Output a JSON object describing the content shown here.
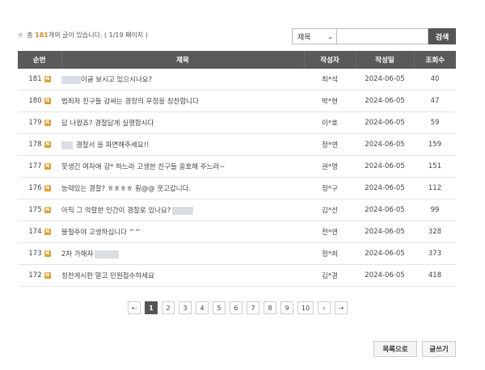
{
  "summary": {
    "star": "※",
    "pre": "총",
    "count": "181",
    "post": "개의 글이 있습니다.",
    "pages": "( 1/19 페이지 )"
  },
  "search": {
    "field": "제목",
    "button": "검색",
    "query": ""
  },
  "columns": {
    "num": "순번",
    "title": "제목",
    "writer": "작성자",
    "date": "작성일",
    "views": "조회수"
  },
  "badge": "N",
  "rows": [
    {
      "num": "181",
      "title": "이글 보시고 있으시나요?",
      "writer": "최*석",
      "date": "2024-06-05",
      "views": "40"
    },
    {
      "num": "180",
      "title": "범죄자 친구들 감싸는 경장의 우정을 칭찬합니다",
      "writer": "박*현",
      "date": "2024-06-05",
      "views": "47"
    },
    {
      "num": "179",
      "title": "답 나왔죠? 경찰답게 실행합시다",
      "writer": "이*호",
      "date": "2024-06-05",
      "views": "59"
    },
    {
      "num": "178",
      "title": "경찰서 을 파면해주세요!!",
      "writer": "정*연",
      "date": "2024-06-05",
      "views": "159"
    },
    {
      "num": "177",
      "title": "못생긴 여자애 강* 하느라 고생한 친구들 옹호해 주느라~",
      "writer": "권*명",
      "date": "2024-06-05",
      "views": "151"
    },
    {
      "num": "176",
      "title": "능력있는 경찰? ㅎㅎㅎㅎ 횡@@ 웃고갑니다.",
      "writer": "정*구",
      "date": "2024-06-05",
      "views": "112"
    },
    {
      "num": "175",
      "title": "아직 그 악랄한 인간이 경찰로 있나요?",
      "writer": "김*선",
      "date": "2024-06-05",
      "views": "99"
    },
    {
      "num": "174",
      "title": "불철주야 고생하십니다 ^^",
      "writer": "전*연",
      "date": "2024-06-05",
      "views": "328"
    },
    {
      "num": "173",
      "title": "2차 가해자",
      "writer": "정*희",
      "date": "2024-06-05",
      "views": "373"
    },
    {
      "num": "172",
      "title": "칭찬게시판 말고 민원접수하세요",
      "writer": "김*경",
      "date": "2024-06-05",
      "views": "418"
    }
  ],
  "pagination": {
    "first": "⇠",
    "prev": "‹",
    "next": "›",
    "last": "⇢",
    "pages": [
      "1",
      "2",
      "3",
      "4",
      "5",
      "6",
      "7",
      "8",
      "9",
      "10"
    ]
  },
  "buttons": {
    "list": "목록으로",
    "write": "글쓰기"
  },
  "colors": {
    "header_bg": "#5a5a5a",
    "badge": "#d9a23a",
    "accent_count": "#c8912e"
  }
}
